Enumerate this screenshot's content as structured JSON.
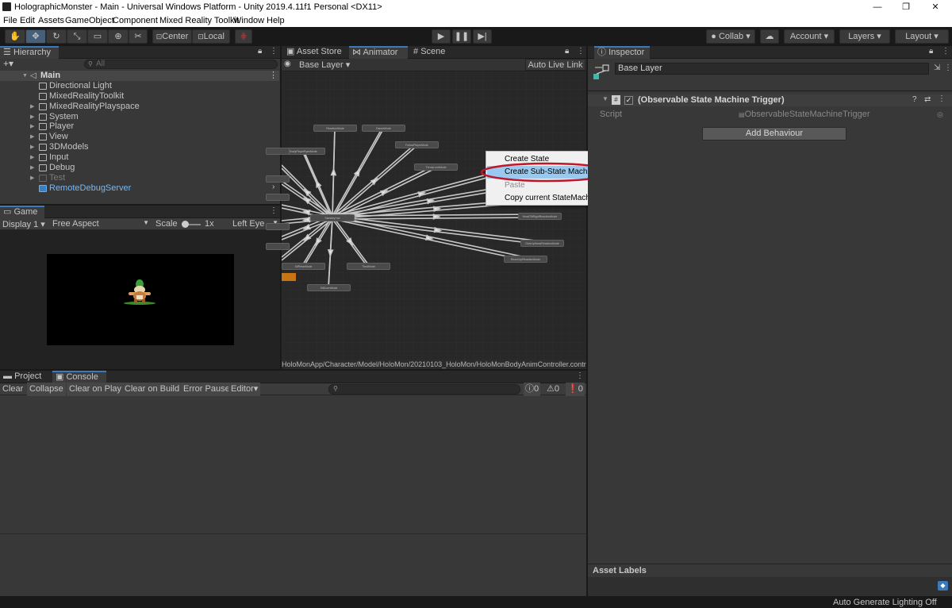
{
  "window": {
    "title": "HolographicMonster - Main - Universal Windows Platform - Unity 2019.4.11f1 Personal <DX11>",
    "minimize": "—",
    "maximize": "❐",
    "close": "✕"
  },
  "menu": [
    "File",
    "Edit",
    "Assets",
    "GameObject",
    "Component",
    "Mixed Reality Toolkit",
    "Window",
    "Help"
  ],
  "toolbar": {
    "tools": [
      {
        "icon": "hand-icon",
        "glyph": "✋"
      },
      {
        "icon": "move-icon",
        "glyph": "✥"
      },
      {
        "icon": "rotate-icon",
        "glyph": "↻"
      },
      {
        "icon": "scale-icon",
        "glyph": "⤡"
      },
      {
        "icon": "rect-icon",
        "glyph": "▭"
      },
      {
        "icon": "transform-icon",
        "glyph": "⊕"
      },
      {
        "icon": "custom-tool-icon",
        "glyph": "✂"
      }
    ],
    "center_label": "Center",
    "local_label": "Local",
    "collab_label": "Collab",
    "account_label": "Account",
    "layers_label": "Layers",
    "layout_label": "Layout"
  },
  "hierarchy": {
    "tab_label": "Hierarchy",
    "search_placeholder": "All",
    "scene_name": "Main",
    "items": [
      {
        "label": "Directional Light",
        "expandable": false,
        "state": "normal"
      },
      {
        "label": "MixedRealityToolkit",
        "expandable": false,
        "state": "normal"
      },
      {
        "label": "MixedRealityPlayspace",
        "expandable": true,
        "state": "normal"
      },
      {
        "label": "System",
        "expandable": true,
        "state": "normal"
      },
      {
        "label": "Player",
        "expandable": true,
        "state": "normal"
      },
      {
        "label": "View",
        "expandable": true,
        "state": "normal"
      },
      {
        "label": "3DModels",
        "expandable": true,
        "state": "normal"
      },
      {
        "label": "Input",
        "expandable": true,
        "state": "normal"
      },
      {
        "label": "Debug",
        "expandable": true,
        "state": "normal"
      },
      {
        "label": "Test",
        "expandable": true,
        "state": "disabled"
      },
      {
        "label": "RemoteDebugServer",
        "expandable": false,
        "state": "prefab"
      }
    ]
  },
  "game": {
    "tab_label": "Game",
    "display_label": "Display 1",
    "aspect_label": "Free Aspect",
    "scale_label": "Scale",
    "scale_value": "1x",
    "eye_label": "Left Eye"
  },
  "center_tabs": {
    "asset_store": "Asset Store",
    "animator": "Animator",
    "scene": "Scene"
  },
  "animator": {
    "layer_label": "Base Layer",
    "live_link_label": "Auto Live Link",
    "path": "HoloMonApp/Character/Model/HoloMon/20210103_HoloMon/HoloMonBodyAnimController.controller",
    "nodes": [
      "ReactionMode",
      "DanceMode",
      "FollowPlayerMode",
      "BodyPlayerEyesMode",
      "ThrowLookMode",
      "StandbyHub",
      "HeadNodReactionMode",
      "HeadShakeReactionMode",
      "HeadTiltLeftReactionMode",
      "HeadTiltRightReactionMode",
      "GiveUpHeadReactionMode",
      "ReachUpReactionMode",
      "SitRelaxMode",
      "TiredMode",
      "SitDownMode"
    ]
  },
  "context_menu": {
    "items": [
      {
        "label": "Create State",
        "submenu": true,
        "enabled": true,
        "highlighted": false
      },
      {
        "label": "Create Sub-State Machine",
        "submenu": false,
        "enabled": true,
        "highlighted": true
      },
      {
        "label": "Paste",
        "submenu": false,
        "enabled": false,
        "highlighted": false
      },
      {
        "label": "Copy current StateMachine",
        "submenu": false,
        "enabled": true,
        "highlighted": false
      }
    ]
  },
  "inspector": {
    "tab_label": "Inspector",
    "object_name": "Base Layer",
    "component_title": "(Observable State Machine Trigger)",
    "script_label": "Script",
    "script_value": "ObservableStateMachineTrigger",
    "add_behaviour_label": "Add Behaviour",
    "asset_labels_title": "Asset Labels"
  },
  "console": {
    "project_tab": "Project",
    "console_tab": "Console",
    "clear": "Clear",
    "collapse": "Collapse",
    "clear_on_play": "Clear on Play",
    "clear_on_build": "Clear on Build",
    "error_pause": "Error Pause",
    "editor": "Editor",
    "info_count": "0",
    "warning_count": "0",
    "error_count": "0"
  },
  "status_bar": {
    "text": "Auto Generate Lighting Off"
  },
  "colors": {
    "accent_blue": "#3a79bb",
    "highlight": "#99c9ef",
    "circle_annotation": "#c0162a",
    "orange_state": "#c87414"
  }
}
